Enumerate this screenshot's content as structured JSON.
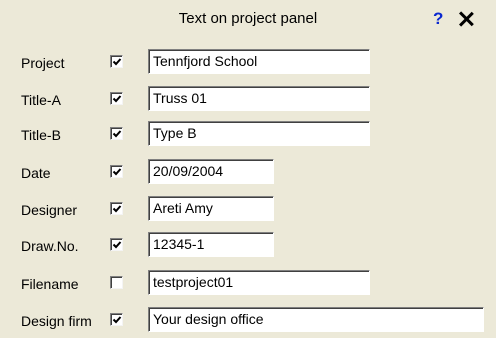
{
  "dialog": {
    "title": "Text on project panel",
    "help_label": "?",
    "close_icon": "close-icon"
  },
  "rows": [
    {
      "label": "Project",
      "checked": true,
      "value": "Tennfjord School"
    },
    {
      "label": "Title-A",
      "checked": true,
      "value": "Truss 01"
    },
    {
      "label": "Title-B",
      "checked": true,
      "value": "Type B"
    },
    {
      "label": "Date",
      "checked": true,
      "value": "20/09/2004"
    },
    {
      "label": "Designer",
      "checked": true,
      "value": "Areti Amy"
    },
    {
      "label": "Draw.No.",
      "checked": true,
      "value": "12345-1"
    },
    {
      "label": "Filename",
      "checked": false,
      "value": "testproject01"
    },
    {
      "label": "Design firm",
      "checked": true,
      "value": "Your design office"
    }
  ],
  "colors": {
    "panel_background": "#ece9d8",
    "help_color": "#0a28d0"
  }
}
